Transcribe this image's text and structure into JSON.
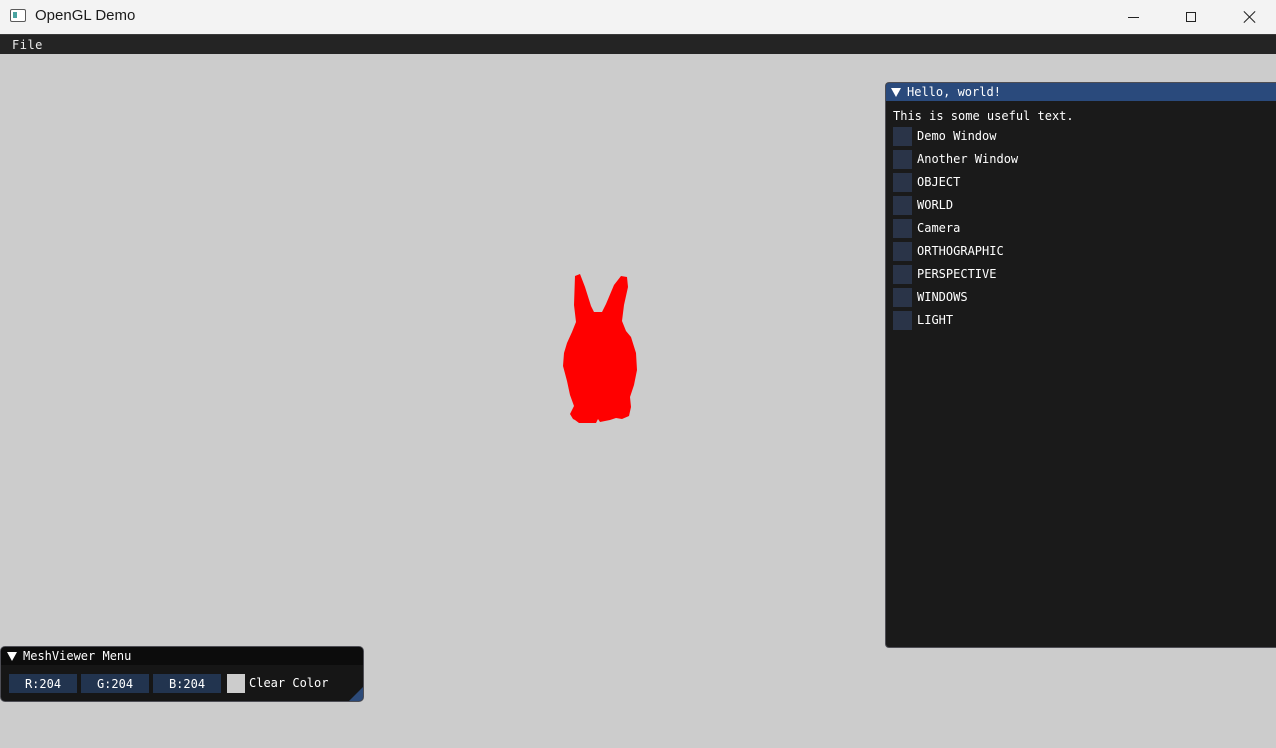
{
  "window": {
    "title": "OpenGL Demo"
  },
  "menubar": {
    "file_label": "File"
  },
  "scene": {
    "mesh_color": "#ff0000",
    "background_color": "#cccccc"
  },
  "hello_panel": {
    "title": "Hello, world!",
    "text": "This is some useful text.",
    "checkboxes": [
      {
        "label": "Demo Window",
        "checked": false
      },
      {
        "label": "Another Window",
        "checked": false
      },
      {
        "label": "OBJECT",
        "checked": false
      },
      {
        "label": "WORLD",
        "checked": false
      },
      {
        "label": "Camera",
        "checked": false
      },
      {
        "label": "ORTHOGRAPHIC",
        "checked": false
      },
      {
        "label": "PERSPECTIVE",
        "checked": false
      },
      {
        "label": "WINDOWS",
        "checked": false
      },
      {
        "label": "LIGHT",
        "checked": false
      }
    ]
  },
  "mesh_menu": {
    "title": "MeshViewer Menu",
    "r_value": "R:204",
    "g_value": "G:204",
    "b_value": "B:204",
    "clear_color_label": "Clear Color",
    "swatch_color": "#cccccc"
  }
}
